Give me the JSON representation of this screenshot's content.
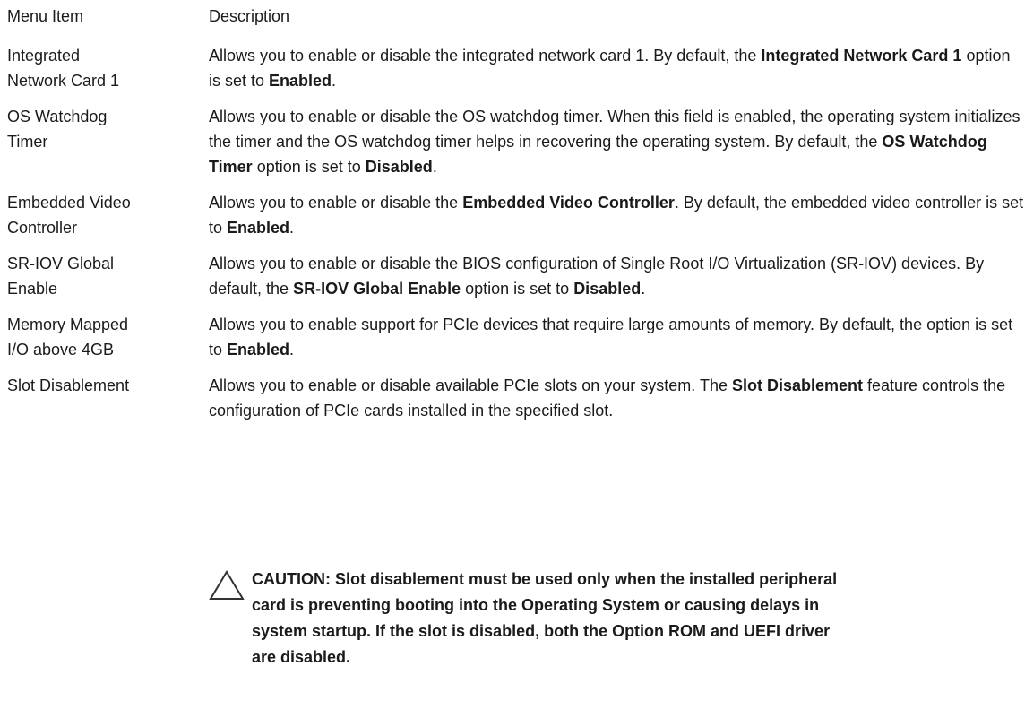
{
  "header": {
    "col1": "Menu Item",
    "col2": "Description"
  },
  "rows": [
    {
      "label_l1": "Integrated",
      "label_l2": "Network Card 1",
      "parts": [
        "Allows you to enable or disable the integrated network card 1. By default, the ",
        "Integrated Network Card 1",
        " option is set to ",
        "Enabled",
        "."
      ]
    },
    {
      "label_l1": "OS Watchdog",
      "label_l2": "Timer",
      "parts": [
        "Allows you to enable or disable the OS watchdog timer. When this field is enabled, the operating system initializes the timer and the OS watchdog timer helps in recovering the operating system. By default, the ",
        "OS Watchdog Timer",
        " option is set to ",
        "Disabled",
        "."
      ]
    },
    {
      "label_l1": "Embedded Video",
      "label_l2": "Controller",
      "parts": [
        "Allows you to enable or disable the ",
        "Embedded Video Controller",
        ". By default, the embedded video controller is set to ",
        "Enabled",
        "."
      ]
    },
    {
      "label_l1": "SR-IOV Global",
      "label_l2": "Enable",
      "parts": [
        "Allows you to enable or disable the BIOS configuration of Single Root I/O Virtualization (SR-IOV) devices. By default, the ",
        "SR-IOV Global Enable",
        " option is set to ",
        "Disabled",
        "."
      ]
    },
    {
      "label_l1": "Memory Mapped",
      "label_l2": "I/O above 4GB",
      "parts": [
        "Allows you to enable support for PCIe devices that require large amounts of memory. By default, the option is set to ",
        "Enabled",
        "."
      ]
    },
    {
      "label_l1": "Slot Disablement",
      "label_l2": "",
      "parts": [
        "Allows you to enable or disable available PCIe slots on your system. The ",
        "Slot Disablement",
        " feature controls the configuration of PCIe cards installed in the specified slot."
      ]
    }
  ],
  "caution": {
    "icon": "warning-triangle-icon",
    "lines": [
      "CAUTION: Slot disablement must be used only when the installed peripheral",
      "card is preventing booting into the Operating System or causing delays in",
      "system startup. If the slot is disabled, both the Option ROM and UEFI driver",
      "are disabled."
    ]
  }
}
